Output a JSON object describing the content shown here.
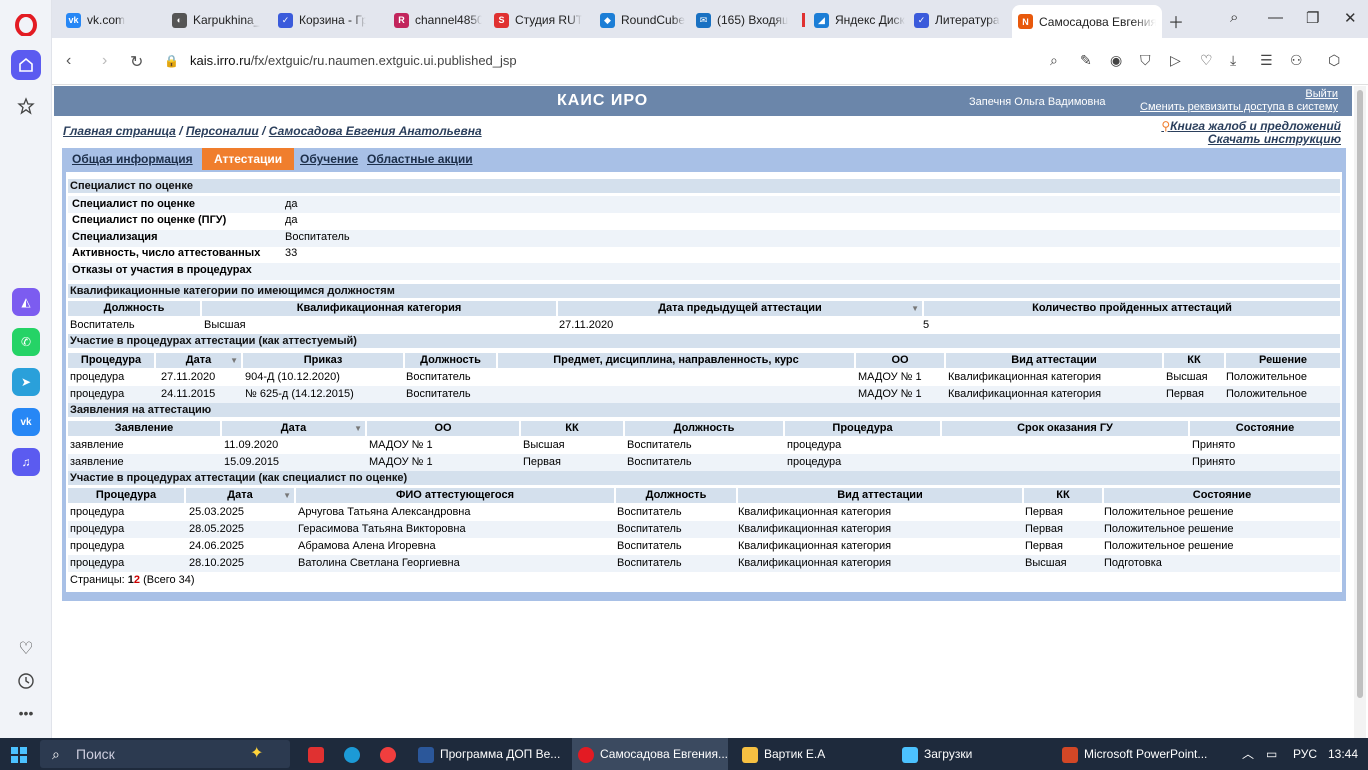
{
  "browser": {
    "tabs": [
      {
        "label": "vk.com",
        "color": "#2787f5",
        "glyph": "vk"
      },
      {
        "label": "Karpukhina_K",
        "color": "#555555",
        "glyph": "◐"
      },
      {
        "label": "Корзина - Гр",
        "color": "#3b5bdb",
        "glyph": "✓"
      },
      {
        "label": "channel4850",
        "color": "#d6336c",
        "glyph": "R"
      },
      {
        "label": "Студия RUTU",
        "color": "#e03131",
        "glyph": "S"
      },
      {
        "label": "RoundCube",
        "color": "#1c7ed6",
        "glyph": "◆"
      },
      {
        "label": "(165) Входящ",
        "color": "#1971c2",
        "glyph": "✉"
      },
      {
        "label": "Яндекс Диск",
        "color": "#1c7ed6",
        "glyph": "◢"
      },
      {
        "label": "Литература",
        "color": "#3b5bdb",
        "glyph": "✓"
      },
      {
        "label": "Самосадова Евгения",
        "color": "#e8590c",
        "glyph": "N"
      }
    ],
    "url_host": "kais.irro.ru",
    "url_path": "/fx/extguic/ru.naumen.extguic.ui.published_jsp"
  },
  "header": {
    "title": "КАИС ИРО",
    "user": "Запечня Ольга Вадимовна",
    "logout": "Выйти",
    "change_credentials": "Сменить реквизиты доступа в систему"
  },
  "breadcrumb": {
    "home": "Главная страница",
    "personnel": "Персоналии",
    "person": "Самосадова Евгения Анатольевна",
    "sep": "/"
  },
  "links": {
    "complaints": "Книга жалоб и предложений",
    "instructions": "Скачать инструкцию"
  },
  "panel_tabs": [
    "Общая информация",
    "Аттестации",
    "Обучение",
    "Областные акции"
  ],
  "specialist": {
    "title": "Специалист по оценке",
    "rows": [
      {
        "label": "Специалист по оценке",
        "value": "да"
      },
      {
        "label": "Специалист по оценке (ПГУ)",
        "value": "да"
      },
      {
        "label": "Специализация",
        "value": "Воспитатель"
      },
      {
        "label": "Активность, число аттестованных",
        "value": "33"
      },
      {
        "label": "Отказы от участия в процедурах",
        "value": ""
      }
    ]
  },
  "qual": {
    "title": "Квалификационные категории по имеющимся должностям",
    "headers": [
      "Должность",
      "Квалификационная категория",
      "Дата предыдущей аттестации",
      "Количество пройденных аттестаций"
    ],
    "rows": [
      [
        "Воспитатель",
        "Высшая",
        "27.11.2020",
        "5"
      ]
    ]
  },
  "attestee": {
    "title": "Участие в процедурах аттестации (как аттестуемый)",
    "headers": [
      "Процедура",
      "Дата",
      "Приказ",
      "Должность",
      "Предмет, дисциплина, направленность, курс",
      "ОО",
      "Вид аттестации",
      "КК",
      "Решение"
    ],
    "rows": [
      [
        "процедура",
        "27.11.2020",
        "904-Д (10.12.2020)",
        "Воспитатель",
        "",
        "МАДОУ № 1",
        "Квалификационная категория",
        "Высшая",
        "Положительное"
      ],
      [
        "процедура",
        "24.11.2015",
        "№ 625-д (14.12.2015)",
        "Воспитатель",
        "",
        "МАДОУ № 1",
        "Квалификационная категория",
        "Первая",
        "Положительное"
      ]
    ]
  },
  "applications": {
    "title": "Заявления на аттестацию",
    "headers": [
      "Заявление",
      "Дата",
      "ОО",
      "КК",
      "Должность",
      "Процедура",
      "Срок оказания ГУ",
      "Состояние"
    ],
    "rows": [
      [
        "заявление",
        "11.09.2020",
        "МАДОУ № 1",
        "Высшая",
        "Воспитатель",
        "процедура",
        "",
        "Принято"
      ],
      [
        "заявление",
        "15.09.2015",
        "МАДОУ № 1",
        "Первая",
        "Воспитатель",
        "процедура",
        "",
        "Принято"
      ]
    ]
  },
  "expert": {
    "title": "Участие в процедурах аттестации (как специалист по оценке)",
    "headers": [
      "Процедура",
      "Дата",
      "ФИО аттестующегося",
      "Должность",
      "Вид аттестации",
      "КК",
      "Состояние"
    ],
    "rows": [
      [
        "процедура",
        "25.03.2025",
        "Арчугова Татьяна Александровна",
        "Воспитатель",
        "Квалификационная категория",
        "Первая",
        "Положительное решение"
      ],
      [
        "процедура",
        "28.05.2025",
        "Герасимова Татьяна Викторовна",
        "Воспитатель",
        "Квалификационная категория",
        "Первая",
        "Положительное решение"
      ],
      [
        "процедура",
        "24.06.2025",
        "Абрамова Алена Игоревна",
        "Воспитатель",
        "Квалификационная категория",
        "Первая",
        "Положительное решение"
      ],
      [
        "процедура",
        "28.10.2025",
        "Ватолина Светлана Георгиевна",
        "Воспитатель",
        "Квалификационная категория",
        "Высшая",
        "Подготовка"
      ]
    ]
  },
  "pagination": {
    "label": "Страницы:",
    "page1": "1",
    "page2": "2",
    "total": "(Всего 34)"
  },
  "taskbar": {
    "search_placeholder": "Поиск",
    "items": [
      "Программа ДОП Ве...",
      "Самосадова Евгения...",
      "Вартик Е.А",
      "Загрузки",
      "Microsoft PowerPoint..."
    ],
    "lang": "РУС",
    "time": "13:44"
  }
}
